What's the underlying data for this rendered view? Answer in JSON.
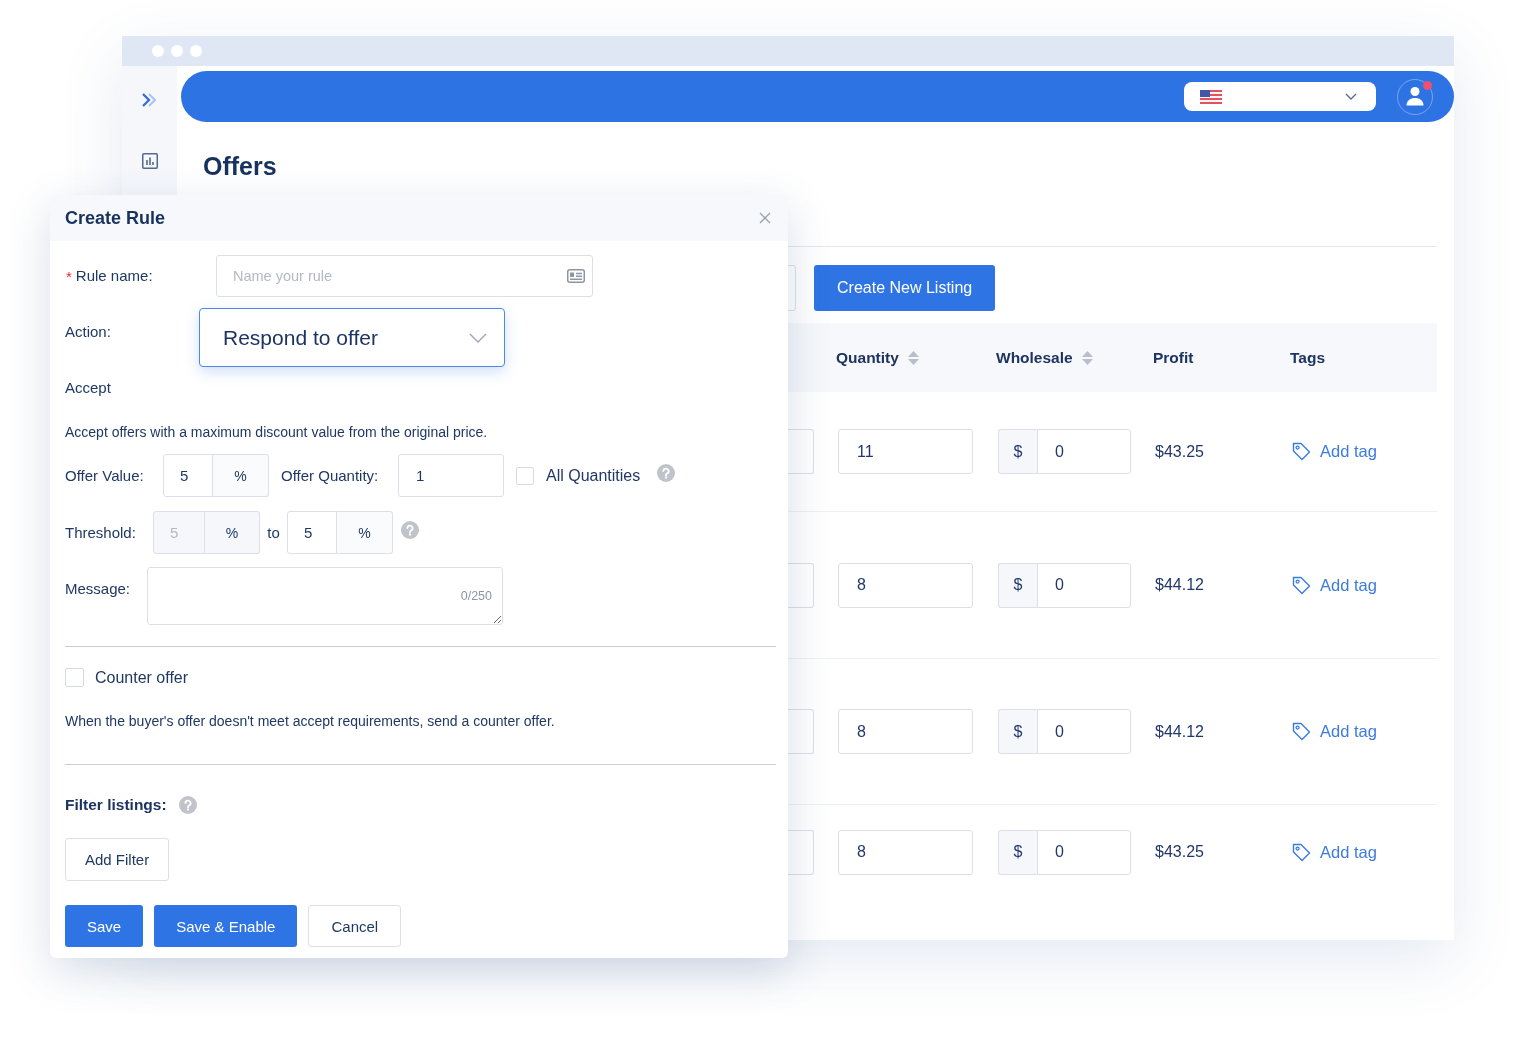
{
  "top_bar": {
    "avatar": {
      "notification": true
    }
  },
  "page": {
    "title": "Offers"
  },
  "toolbar": {
    "create_button": "Create New Listing"
  },
  "table": {
    "columns": [
      {
        "label": "Quantity",
        "sortable": true
      },
      {
        "label": "Wholesale",
        "sortable": true
      },
      {
        "label": "Profit",
        "sortable": false
      },
      {
        "label": "Tags",
        "sortable": false
      }
    ],
    "rows": [
      {
        "quantity": "11",
        "currency": "$",
        "wholesale": "0",
        "profit": "$43.25",
        "tag_link": "Add tag"
      },
      {
        "quantity": "8",
        "currency": "$",
        "wholesale": "0",
        "profit": "$44.12",
        "tag_link": "Add tag"
      },
      {
        "quantity": "8",
        "currency": "$",
        "wholesale": "0",
        "profit": "$44.12",
        "tag_link": "Add tag"
      },
      {
        "quantity": "8",
        "currency": "$",
        "wholesale": "0",
        "profit": "$43.25",
        "tag_link": "Add tag"
      }
    ]
  },
  "modal": {
    "title": "Create Rule",
    "rule_name": {
      "required_mark": "*",
      "label": "Rule name:",
      "placeholder": "Name your rule"
    },
    "action": {
      "label": "Action:",
      "value": "Respond to offer"
    },
    "accept": {
      "heading": "Accept",
      "description": "Accept offers with a maximum discount value from the original price.",
      "offer_value": {
        "label": "Offer Value:",
        "value": "5",
        "unit": "%"
      },
      "offer_quantity": {
        "label": "Offer Quantity:",
        "value": "1"
      },
      "all_quantities": {
        "label": "All Quantities",
        "checked": false
      },
      "threshold": {
        "label": "Threshold:",
        "from": {
          "value": "5",
          "unit": "%",
          "disabled": true
        },
        "separator": "to",
        "to": {
          "value": "5",
          "unit": "%",
          "disabled": false
        }
      },
      "message": {
        "label": "Message:",
        "counter": "0/250"
      }
    },
    "counter_offer": {
      "label": "Counter offer",
      "checked": false,
      "description": "When the buyer's offer doesn't meet accept requirements, send a counter offer."
    },
    "filter_listings": {
      "label": "Filter listings:",
      "button": "Add Filter"
    },
    "buttons": [
      {
        "label": "Save",
        "kind": "primary"
      },
      {
        "label": "Save & Enable",
        "kind": "primary"
      },
      {
        "label": "Cancel",
        "kind": "default"
      }
    ]
  }
}
